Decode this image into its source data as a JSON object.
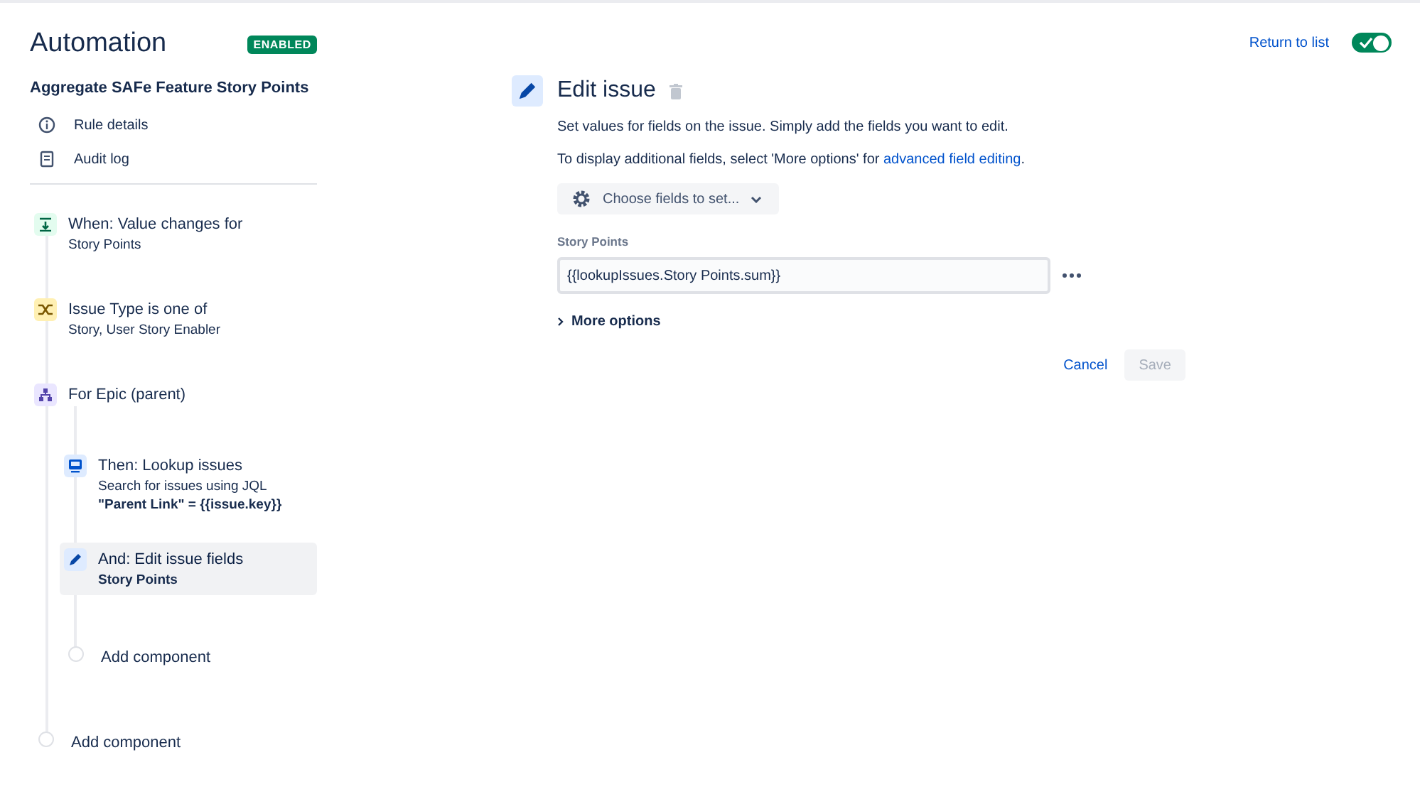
{
  "header": {
    "title": "Automation",
    "status": "ENABLED",
    "return_link": "Return to list",
    "enabled_toggle": {
      "on": true
    }
  },
  "rule": {
    "name": "Aggregate SAFe Feature Story Points"
  },
  "rule_menu": [
    {
      "label": "Rule details",
      "kind": "info"
    },
    {
      "label": "Audit log",
      "kind": "log"
    }
  ],
  "steps": [
    {
      "kind": "trigger",
      "title": "When: Value changes for",
      "lines": [
        {
          "text": "Story Points",
          "bold": false
        }
      ],
      "selected": false
    },
    {
      "kind": "condition",
      "title": "Issue Type is one of",
      "lines": [
        {
          "text": "Story, User Story Enabler",
          "bold": false
        }
      ],
      "selected": false
    },
    {
      "kind": "branch",
      "title": "For Epic (parent)",
      "selected": false,
      "children": [
        {
          "kind": "lookup",
          "title": "Then: Lookup issues",
          "lines": [
            {
              "text": "Search for issues using JQL",
              "bold": false
            },
            {
              "text": "\"Parent Link\" = {{issue.key}}",
              "bold": true
            }
          ],
          "selected": false
        },
        {
          "kind": "action",
          "title": "And: Edit issue fields",
          "lines": [
            {
              "text": "Story Points",
              "bold": true
            }
          ],
          "selected": true
        },
        {
          "kind": "add",
          "title": "Add component",
          "selected": false
        }
      ]
    },
    {
      "kind": "add",
      "title": "Add component",
      "selected": false
    }
  ],
  "editor": {
    "title": "Edit issue",
    "description": "Set values for fields on the issue. Simply add the fields you want to edit.",
    "hint": "To display additional fields, select 'More options' for",
    "hint_link": "advanced field editing",
    "hint_end": ".",
    "chooser": "Choose fields to set...",
    "field_label": "Story Points",
    "field_value": "{{lookupIssues.Story Points.sum}}",
    "more_options": "More options",
    "more_expanded": false,
    "cancel": "Cancel",
    "save": "Save",
    "save_disabled": true
  }
}
